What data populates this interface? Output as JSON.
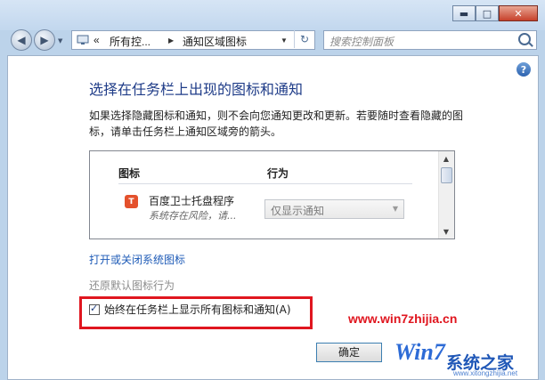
{
  "window": {
    "minimize_glyph": "▬",
    "maximize_glyph": "□",
    "close_glyph": "✕"
  },
  "nav": {
    "back_glyph": "◀",
    "forward_glyph": "▶",
    "address_chevron": "«",
    "address_part1": "所有控...",
    "address_part2": "通知区域图标",
    "address_drop": "▼",
    "refresh_glyph": "↻",
    "search_placeholder": "搜索控制面板"
  },
  "content": {
    "help_glyph": "?",
    "title": "选择在任务栏上出现的图标和通知",
    "description": "如果选择隐藏图标和通知，则不会向您通知更改和更新。若要随时查看隐藏的图标，请单击任务栏上通知区域旁的箭头。",
    "list": {
      "col_icon": "图标",
      "col_behavior": "行为",
      "items": [
        {
          "icon_glyph": "T",
          "name": "百度卫士托盘程序",
          "sub": "系统存在风险，请...",
          "behavior": "仅显示通知"
        }
      ]
    },
    "link_system_icons": "打开或关闭系统图标",
    "restore_defaults": "还原默认图标行为",
    "always_show_label": "始终在任务栏上显示所有图标和通知(A)",
    "always_show_checked": true,
    "ok_label": "确定"
  },
  "watermark": {
    "url": "www.win7zhijia.cn",
    "brand": "系统之家",
    "logo_text": "Win7",
    "small": "www.xitongzhijia.net"
  },
  "colors": {
    "title_blue": "#1f3c88",
    "link_blue": "#1e5bb7",
    "highlight_red": "#e0161f"
  }
}
